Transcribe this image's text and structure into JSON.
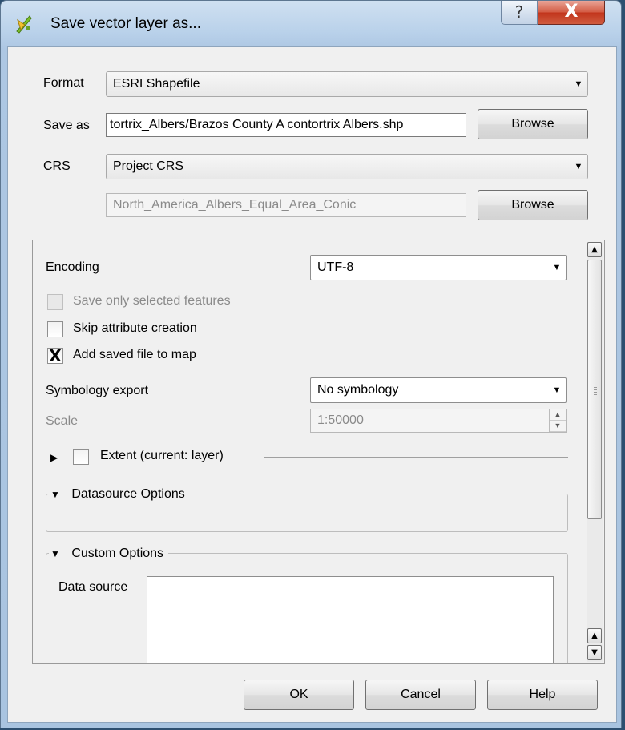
{
  "window": {
    "title": "Save vector layer as...",
    "help_glyph": "?",
    "close_glyph": "X"
  },
  "format": {
    "label": "Format",
    "value": "ESRI Shapefile"
  },
  "save_as": {
    "label": "Save as",
    "value": "tortrix_Albers/Brazos County A contortrix Albers.shp",
    "browse_label": "Browse"
  },
  "crs": {
    "label": "CRS",
    "value": "Project CRS",
    "projection": "North_America_Albers_Equal_Area_Conic",
    "browse_label": "Browse"
  },
  "options": {
    "encoding_label": "Encoding",
    "encoding_value": "UTF-8",
    "save_selected_label": "Save only selected features",
    "skip_attr_label": "Skip attribute creation",
    "add_to_map_label": "Add saved file to map",
    "add_to_map_check": "X",
    "symbology_label": "Symbology export",
    "symbology_value": "No symbology",
    "scale_label": "Scale",
    "scale_value": "1:50000",
    "extent_label": "Extent (current: layer)",
    "datasource_label": "Datasource Options",
    "custom_label": "Custom Options",
    "data_source_label": "Data source"
  },
  "buttons": {
    "ok": "OK",
    "cancel": "Cancel",
    "help": "Help"
  },
  "icons": {
    "combo_arrow": "▼",
    "expanded": "▼",
    "collapsed": "▶",
    "scroll_up": "▲",
    "scroll_down": "▼"
  }
}
